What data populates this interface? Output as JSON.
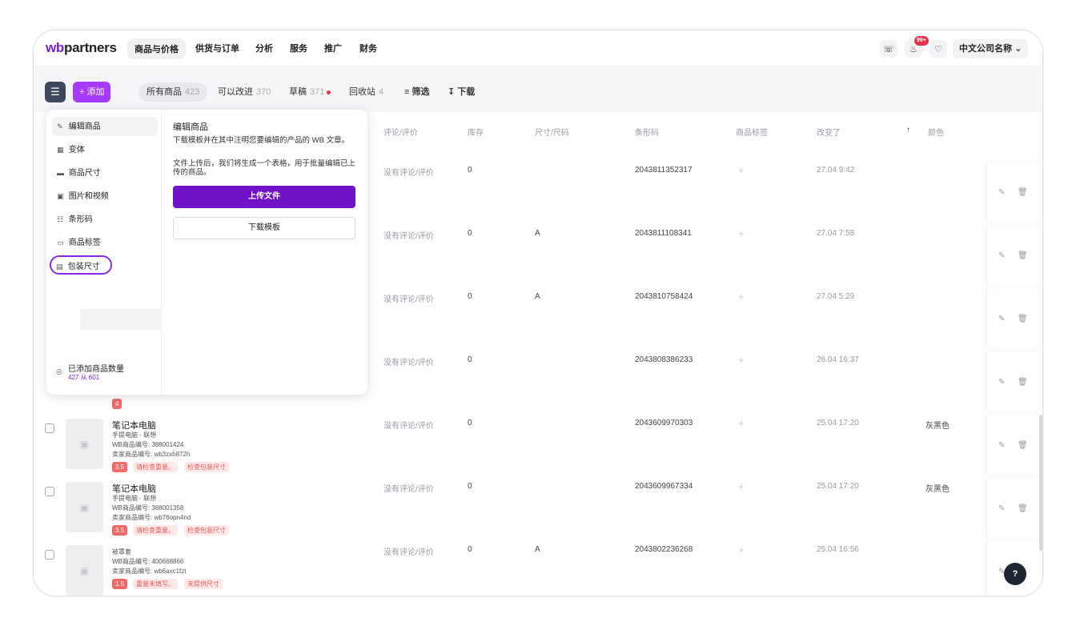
{
  "logo": {
    "prefix": "wb",
    "suffix": "partners"
  },
  "nav": [
    "商品与价格",
    "供货与订单",
    "分析",
    "服务",
    "推广",
    "财务"
  ],
  "topbar": {
    "notifications_badge": "99+",
    "company": "中文公司名称"
  },
  "toolbar": {
    "add_label": "+ 添加",
    "tabs": [
      {
        "label": "所有商品",
        "count": "423"
      },
      {
        "label": "可以改进",
        "count": "370"
      },
      {
        "label": "草稿",
        "count": "371"
      },
      {
        "label": "回收站",
        "count": "4"
      }
    ],
    "filter_label": "筛选",
    "download_label": "下载"
  },
  "table": {
    "headers": [
      "评论/评价",
      "库存",
      "尺寸/尺码",
      "条形码",
      "商品标签",
      "改变了",
      "颜色"
    ],
    "rows": [
      {
        "reviews": "没有评论/评价",
        "stock": "0",
        "size": "",
        "barcode": "2043811352317",
        "changed": "27.04 9:42",
        "color": ""
      },
      {
        "reviews": "没有评论/评价",
        "stock": "0",
        "size": "A",
        "barcode": "2043811108341",
        "changed": "27.04 7:58",
        "color": ""
      },
      {
        "reviews": "没有评论/评价",
        "stock": "0",
        "size": "A",
        "barcode": "2043810758424",
        "changed": "27.04 5:29",
        "color": ""
      },
      {
        "reviews": "没有评论/评价",
        "stock": "0",
        "size": "",
        "barcode": "2043808386233",
        "changed": "26.04 16:37",
        "color": ""
      },
      {
        "reviews": "没有评论/评价",
        "stock": "0",
        "size": "",
        "barcode": "2043609970303",
        "changed": "25.04 17:20",
        "color": "灰黑色"
      },
      {
        "reviews": "没有评论/评价",
        "stock": "0",
        "size": "",
        "barcode": "2043609967334",
        "changed": "25.04 17:20",
        "color": "灰黑色"
      },
      {
        "reviews": "没有评论/评价",
        "stock": "0",
        "size": "A",
        "barcode": "2043802236268",
        "changed": "25.04 16:56",
        "color": ""
      }
    ],
    "products": [
      {
        "title": "笔记本电脑",
        "category": "手提电脑 · 联想",
        "wb_id": "WB商品编号: 388001424",
        "seller_id": "卖家商品编号: wb3zxh872h",
        "rating": "3.5",
        "tag1": "请检查重量。",
        "tag2": "检查包装尺寸"
      },
      {
        "title": "笔记本电脑",
        "category": "手提电脑 · 联想",
        "wb_id": "WB商品编号: 388001358",
        "seller_id": "卖家商品编号: wb76opn4nd",
        "rating": "3.5",
        "tag1": "请检查重量。",
        "tag2": "检查包装尺寸"
      },
      {
        "title": "",
        "category": "被罩套",
        "wb_id": "WB商品编号: 400668866",
        "seller_id": "卖家商品编号: wb6axc1fzt",
        "rating": "1.5",
        "tag1": "重量未填写。",
        "tag2": "未提供尺寸"
      }
    ],
    "partial_rating": "4"
  },
  "popup": {
    "menu": [
      "编辑商品",
      "变体",
      "商品尺寸",
      "图片和视频",
      "条形码",
      "商品标签",
      "包装尺寸"
    ],
    "count_label": "已添加商品数量",
    "count_value": "427 从 601",
    "title": "编辑商品",
    "text1": "下载模板并在其中注明您要编辑的产品的 WB 文章。",
    "text2": "文件上传后，我们将生成一个表格，用于批量编辑已上传的商品。",
    "upload_label": "上传文件",
    "template_label": "下载模板"
  },
  "help_label": "?"
}
